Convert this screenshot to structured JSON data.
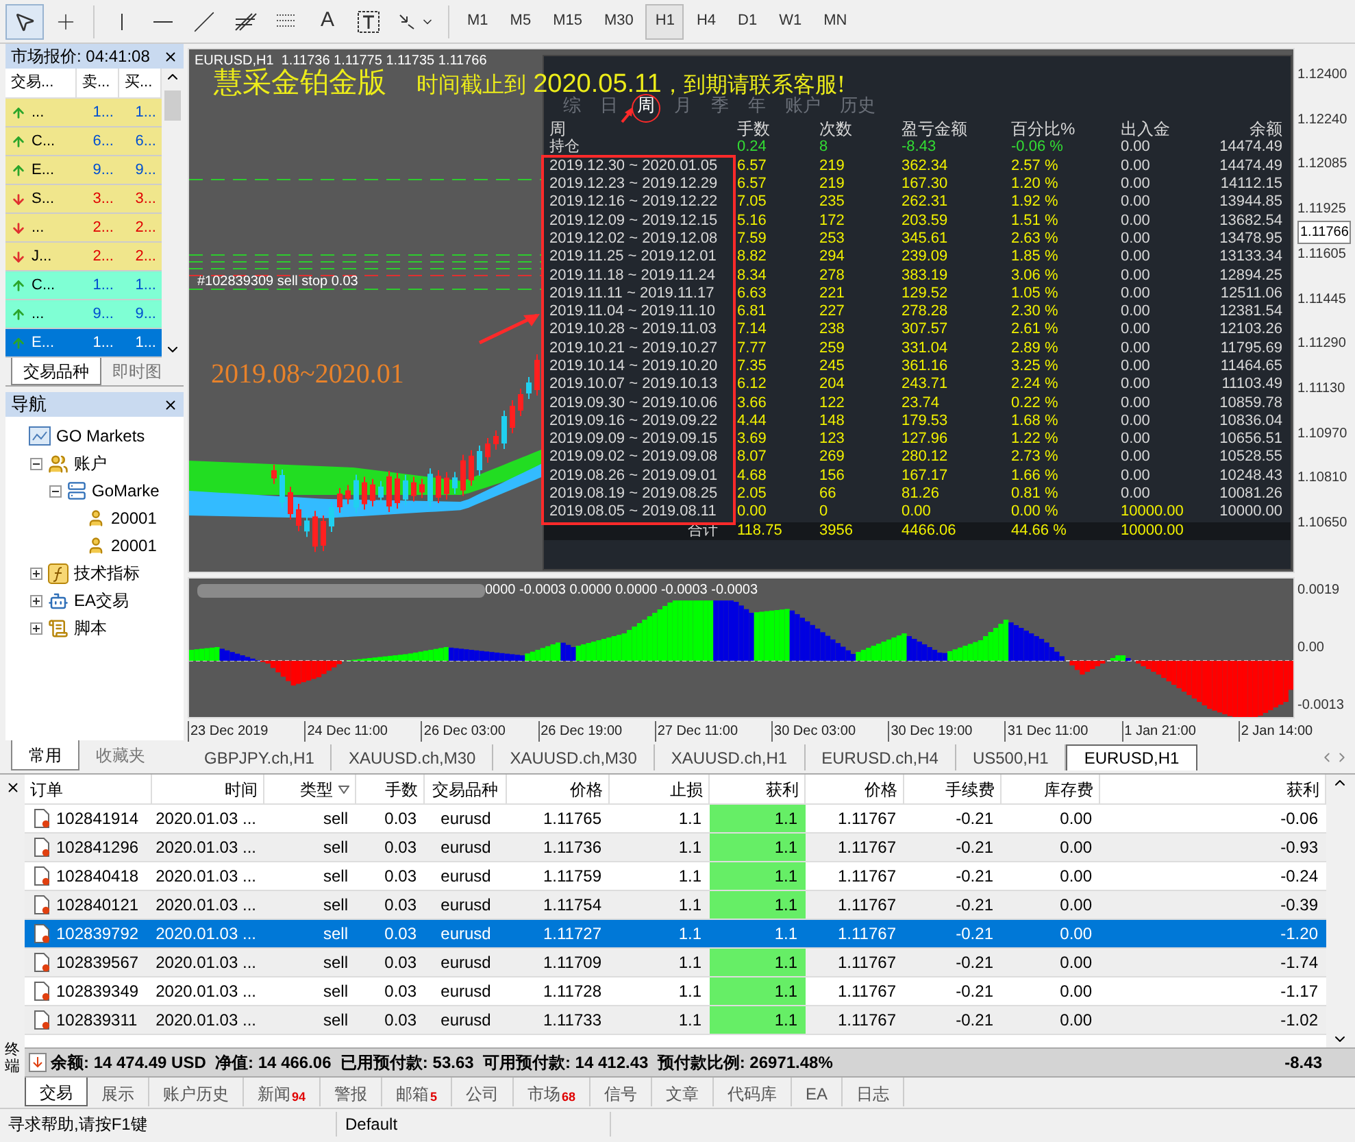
{
  "toolbar": {
    "text_tool": "A",
    "timeframes": [
      {
        "label": "M1",
        "selected": false
      },
      {
        "label": "M5",
        "selected": false
      },
      {
        "label": "M15",
        "selected": false
      },
      {
        "label": "M30",
        "selected": false
      },
      {
        "label": "H1",
        "selected": true
      },
      {
        "label": "H4",
        "selected": false
      },
      {
        "label": "D1",
        "selected": false
      },
      {
        "label": "W1",
        "selected": false
      },
      {
        "label": "MN",
        "selected": false
      }
    ]
  },
  "market_watch": {
    "title": "市场报价: 04:41:08",
    "columns": [
      "交易...",
      "卖...",
      "买..."
    ],
    "rows": [
      {
        "kind": "up",
        "symbol": "...",
        "bid": "1...",
        "ask": "1...",
        "color": "#f0e68c",
        "selected": false
      },
      {
        "kind": "up",
        "symbol": "C...",
        "bid": "6...",
        "ask": "6...",
        "color": "#f0e68c",
        "selected": false
      },
      {
        "kind": "up",
        "symbol": "E...",
        "bid": "9...",
        "ask": "9...",
        "color": "#f0e68c",
        "selected": false
      },
      {
        "kind": "down",
        "symbol": "S...",
        "bid": "3...",
        "ask": "3...",
        "color": "#f0e68c",
        "selected": false
      },
      {
        "kind": "down",
        "symbol": "...",
        "bid": "2...",
        "ask": "2...",
        "color": "#f0e68c",
        "selected": false
      },
      {
        "kind": "down",
        "symbol": "J...",
        "bid": "2...",
        "ask": "2...",
        "color": "#f0e68c",
        "selected": false
      },
      {
        "kind": "up",
        "symbol": "C...",
        "bid": "1...",
        "ask": "1...",
        "color": "#7fffd4",
        "selected": false
      },
      {
        "kind": "up",
        "symbol": "...",
        "bid": "9...",
        "ask": "9...",
        "color": "#7fffd4",
        "selected": false
      },
      {
        "kind": "up",
        "symbol": "E...",
        "bid": "1...",
        "ask": "1...",
        "selected": true
      }
    ],
    "tabs": [
      {
        "label": "交易品种",
        "selected": true
      },
      {
        "label": "即时图",
        "selected": false
      }
    ]
  },
  "navigator": {
    "title": "导航",
    "tree": [
      {
        "kind": "broker",
        "label": "GO Markets",
        "children": [
          {
            "kind": "accounts",
            "label": "账户",
            "expanded": true,
            "children": [
              {
                "kind": "server",
                "label": "GoMarke",
                "expanded": true,
                "children": [
                  {
                    "kind": "account",
                    "label": "20001"
                  },
                  {
                    "kind": "account",
                    "label": "20001"
                  }
                ]
              }
            ]
          },
          {
            "kind": "indicators",
            "label": "技术指标",
            "expanded": false
          },
          {
            "kind": "experts",
            "label": "EA交易",
            "expanded": false
          },
          {
            "kind": "scripts",
            "label": "脚本",
            "expanded": false
          }
        ]
      }
    ],
    "tabs": [
      {
        "label": "常用",
        "selected": true
      },
      {
        "label": "收藏夹",
        "selected": false
      }
    ]
  },
  "chart": {
    "title": "EURUSD,H1  1.11736 1.11775 1.11735 1.11766",
    "banner": "慧采金铂金版",
    "notice_prefix": "时间截止到 ",
    "notice_date": "2020.05.11",
    "notice_suffix": "，到期请联系客服!",
    "period_note": "2019.08~2020.01",
    "order_label": "#102839309 sell stop 0.03",
    "price_ticks": [
      {
        "label": "1.12400",
        "current": false
      },
      {
        "label": "1.12240",
        "current": false
      },
      {
        "label": "1.12085",
        "current": false
      },
      {
        "label": "1.11925",
        "current": false
      },
      {
        "label": "1.11766",
        "current": true
      },
      {
        "label": "1.11605",
        "current": false
      },
      {
        "label": "1.11445",
        "current": false
      },
      {
        "label": "1.11290",
        "current": false
      },
      {
        "label": "1.11130",
        "current": false
      },
      {
        "label": "1.10970",
        "current": false
      },
      {
        "label": "1.10810",
        "current": false
      },
      {
        "label": "1.10650",
        "current": false
      }
    ],
    "stats": {
      "tabs": [
        {
          "label": "综",
          "selected": false
        },
        {
          "label": "日",
          "selected": false
        },
        {
          "label": "周",
          "selected": true
        },
        {
          "label": "月",
          "selected": false
        },
        {
          "label": "季",
          "selected": false
        },
        {
          "label": "年",
          "selected": false
        },
        {
          "label": "账户",
          "selected": false
        },
        {
          "label": "历史",
          "selected": false
        }
      ],
      "columns": [
        "周",
        "手数",
        "次数",
        "盈亏金额",
        "百分比%",
        "出入金",
        "余额"
      ],
      "rows": [
        {
          "kind": "holding",
          "cells": [
            "持仓",
            "0.24",
            "8",
            "-8.43",
            "-0.06 %",
            "0.00",
            "14474.49"
          ]
        },
        {
          "kind": "week",
          "cells": [
            "2019.12.30 ~ 2020.01.05",
            "6.57",
            "219",
            "362.34",
            "2.57 %",
            "0.00",
            "14474.49"
          ]
        },
        {
          "kind": "week",
          "cells": [
            "2019.12.23 ~ 2019.12.29",
            "6.57",
            "219",
            "167.30",
            "1.20 %",
            "0.00",
            "14112.15"
          ]
        },
        {
          "kind": "week",
          "cells": [
            "2019.12.16 ~ 2019.12.22",
            "7.05",
            "235",
            "262.31",
            "1.92 %",
            "0.00",
            "13944.85"
          ]
        },
        {
          "kind": "week",
          "cells": [
            "2019.12.09 ~ 2019.12.15",
            "5.16",
            "172",
            "203.59",
            "1.51 %",
            "0.00",
            "13682.54"
          ]
        },
        {
          "kind": "week",
          "cells": [
            "2019.12.02 ~ 2019.12.08",
            "7.59",
            "253",
            "345.61",
            "2.63 %",
            "0.00",
            "13478.95"
          ]
        },
        {
          "kind": "week",
          "cells": [
            "2019.11.25 ~ 2019.12.01",
            "8.82",
            "294",
            "239.09",
            "1.85 %",
            "0.00",
            "13133.34"
          ]
        },
        {
          "kind": "week",
          "cells": [
            "2019.11.18 ~ 2019.11.24",
            "8.34",
            "278",
            "383.19",
            "3.06 %",
            "0.00",
            "12894.25"
          ]
        },
        {
          "kind": "week",
          "cells": [
            "2019.11.11 ~ 2019.11.17",
            "6.63",
            "221",
            "129.52",
            "1.05 %",
            "0.00",
            "12511.06"
          ]
        },
        {
          "kind": "week",
          "cells": [
            "2019.11.04 ~ 2019.11.10",
            "6.81",
            "227",
            "278.28",
            "2.30 %",
            "0.00",
            "12381.54"
          ]
        },
        {
          "kind": "week",
          "cells": [
            "2019.10.28 ~ 2019.11.03",
            "7.14",
            "238",
            "307.57",
            "2.61 %",
            "0.00",
            "12103.26"
          ]
        },
        {
          "kind": "week",
          "cells": [
            "2019.10.21 ~ 2019.10.27",
            "7.77",
            "259",
            "331.04",
            "2.89 %",
            "0.00",
            "11795.69"
          ]
        },
        {
          "kind": "week",
          "cells": [
            "2019.10.14 ~ 2019.10.20",
            "7.35",
            "245",
            "361.16",
            "3.25 %",
            "0.00",
            "11464.65"
          ]
        },
        {
          "kind": "week",
          "cells": [
            "2019.10.07 ~ 2019.10.13",
            "6.12",
            "204",
            "243.71",
            "2.24 %",
            "0.00",
            "11103.49"
          ]
        },
        {
          "kind": "week",
          "cells": [
            "2019.09.30 ~ 2019.10.06",
            "3.66",
            "122",
            "23.74",
            "0.22 %",
            "0.00",
            "10859.78"
          ]
        },
        {
          "kind": "week",
          "cells": [
            "2019.09.16 ~ 2019.09.22",
            "4.44",
            "148",
            "179.53",
            "1.68 %",
            "0.00",
            "10836.04"
          ]
        },
        {
          "kind": "week",
          "cells": [
            "2019.09.09 ~ 2019.09.15",
            "3.69",
            "123",
            "127.96",
            "1.22 %",
            "0.00",
            "10656.51"
          ]
        },
        {
          "kind": "week",
          "cells": [
            "2019.09.02 ~ 2019.09.08",
            "8.07",
            "269",
            "280.12",
            "2.73 %",
            "0.00",
            "10528.55"
          ]
        },
        {
          "kind": "week",
          "cells": [
            "2019.08.26 ~ 2019.09.01",
            "4.68",
            "156",
            "167.17",
            "1.66 %",
            "0.00",
            "10248.43"
          ]
        },
        {
          "kind": "week",
          "cells": [
            "2019.08.19 ~ 2019.08.25",
            "2.05",
            "66",
            "81.26",
            "0.81 %",
            "0.00",
            "10081.26"
          ]
        },
        {
          "kind": "deposit",
          "cells": [
            "2019.08.05 ~ 2019.08.11",
            "0.00",
            "0",
            "0.00",
            "0.00 %",
            "10000.00",
            "10000.00"
          ]
        },
        {
          "kind": "total",
          "cells": [
            "合计",
            "118.75",
            "3956",
            "4466.06",
            "44.66 %",
            "10000.00"
          ]
        }
      ]
    },
    "indicator": {
      "values": "0000 -0.0003 0.0000 0.0000 -0.0003 -0.0003",
      "ticks": [
        "0.0019",
        "0.00",
        "-0.0013"
      ]
    },
    "time_ticks": [
      "23 Dec 2019",
      "24 Dec 11:00",
      "26 Dec 03:00",
      "26 Dec 19:00",
      "27 Dec 11:00",
      "30 Dec 03:00",
      "30 Dec 19:00",
      "31 Dec 11:00",
      "1 Jan 21:00",
      "2 Jan 14:00"
    ]
  },
  "chart_tabs": [
    {
      "label": "GBPJPY.ch,H1",
      "selected": false
    },
    {
      "label": "XAUUSD.ch,M30",
      "selected": false
    },
    {
      "label": "XAUUSD.ch,M30",
      "selected": false
    },
    {
      "label": "XAUUSD.ch,H1",
      "selected": false
    },
    {
      "label": "EURUSD.ch,H4",
      "selected": false
    },
    {
      "label": "US500,H1",
      "selected": false
    },
    {
      "label": "EURUSD,H1",
      "selected": true
    }
  ],
  "terminal": {
    "side_label": "终端",
    "columns": [
      "订单",
      "时间",
      "类型",
      "手数",
      "交易品种",
      "价格",
      "止损",
      "获利",
      "价格",
      "手续费",
      "库存费",
      "获利"
    ],
    "orders": [
      {
        "selected": false,
        "cells": [
          "102841914",
          "2020.01.03 ...",
          "sell",
          "0.03",
          "eurusd",
          "1.11765",
          "1.1",
          "1.1",
          "1.11767",
          "-0.21",
          "0.00",
          "-0.06"
        ]
      },
      {
        "selected": false,
        "cells": [
          "102841296",
          "2020.01.03 ...",
          "sell",
          "0.03",
          "eurusd",
          "1.11736",
          "1.1",
          "1.1",
          "1.11767",
          "-0.21",
          "0.00",
          "-0.93"
        ]
      },
      {
        "selected": false,
        "cells": [
          "102840418",
          "2020.01.03 ...",
          "sell",
          "0.03",
          "eurusd",
          "1.11759",
          "1.1",
          "1.1",
          "1.11767",
          "-0.21",
          "0.00",
          "-0.24"
        ]
      },
      {
        "selected": false,
        "cells": [
          "102840121",
          "2020.01.03 ...",
          "sell",
          "0.03",
          "eurusd",
          "1.11754",
          "1.1",
          "1.1",
          "1.11767",
          "-0.21",
          "0.00",
          "-0.39"
        ]
      },
      {
        "selected": true,
        "cells": [
          "102839792",
          "2020.01.03 ...",
          "sell",
          "0.03",
          "eurusd",
          "1.11727",
          "1.1",
          "1.1",
          "1.11767",
          "-0.21",
          "0.00",
          "-1.20"
        ]
      },
      {
        "selected": false,
        "cells": [
          "102839567",
          "2020.01.03 ...",
          "sell",
          "0.03",
          "eurusd",
          "1.11709",
          "1.1",
          "1.1",
          "1.11767",
          "-0.21",
          "0.00",
          "-1.74"
        ]
      },
      {
        "selected": false,
        "cells": [
          "102839349",
          "2020.01.03 ...",
          "sell",
          "0.03",
          "eurusd",
          "1.11728",
          "1.1",
          "1.1",
          "1.11767",
          "-0.21",
          "0.00",
          "-1.17"
        ]
      },
      {
        "selected": false,
        "cells": [
          "102839311",
          "2020.01.03 ...",
          "sell",
          "0.03",
          "eurusd",
          "1.11733",
          "1.1",
          "1.1",
          "1.11767",
          "-0.21",
          "0.00",
          "-1.02"
        ]
      }
    ],
    "summary": "余额: 14 474.49 USD  净值: 14 466.06  已用预付款: 53.63  可用预付款: 14 412.43  预付款比例: 26971.48%",
    "summary_profit": "-8.43",
    "tabs": [
      {
        "label": "交易",
        "selected": true
      },
      {
        "label": "展示",
        "selected": false
      },
      {
        "label": "账户历史",
        "selected": false
      },
      {
        "label": "新闻",
        "badge": "94",
        "selected": false
      },
      {
        "label": "警报",
        "selected": false
      },
      {
        "label": "邮箱",
        "badge": "5",
        "selected": false
      },
      {
        "label": "公司",
        "selected": false
      },
      {
        "label": "市场",
        "badge": "68",
        "selected": false
      },
      {
        "label": "信号",
        "selected": false
      },
      {
        "label": "文章",
        "selected": false
      },
      {
        "label": "代码库",
        "selected": false
      },
      {
        "label": "EA",
        "selected": false
      },
      {
        "label": "日志",
        "selected": false
      }
    ]
  },
  "status_bar": [
    "寻求帮助,请按F1键",
    "Default"
  ]
}
